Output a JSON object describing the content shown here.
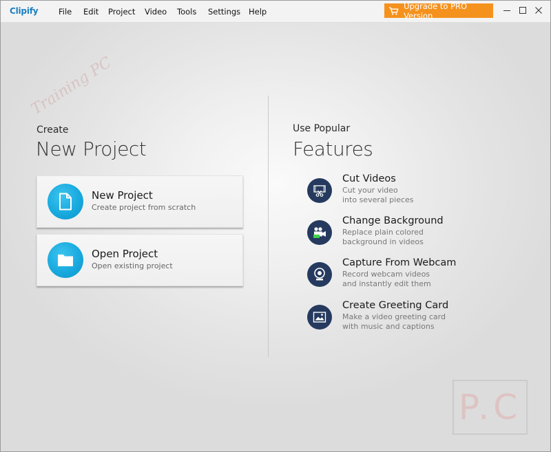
{
  "app": {
    "logo": "Clipify"
  },
  "menu": [
    "File",
    "Edit",
    "Project",
    "Video",
    "Tools",
    "Settings",
    "Help"
  ],
  "upgrade_label": "Upgrade to PRO Version",
  "colors": {
    "accent_orange": "#f5921e",
    "card_blue": "#16a7dd",
    "feature_navy": "#253a5e",
    "logo_blue": "#1a7fc1"
  },
  "create": {
    "kicker": "Create",
    "title": "New Project",
    "cards": [
      {
        "title": "New Project",
        "subtitle": "Create project from scratch",
        "icon": "file-icon"
      },
      {
        "title": "Open Project",
        "subtitle": "Open existing project",
        "icon": "folder-icon"
      }
    ]
  },
  "features": {
    "kicker": "Use Popular",
    "title": "Features",
    "items": [
      {
        "title": "Cut Videos",
        "line1": "Cut your video",
        "line2": "into several pieces",
        "icon": "cut-video-icon"
      },
      {
        "title": "Change Background",
        "line1": "Replace plain colored",
        "line2": "background in videos",
        "icon": "chroma-key-icon"
      },
      {
        "title": "Capture From Webcam",
        "line1": "Record webcam videos",
        "line2": "and instantly edit them",
        "icon": "webcam-icon"
      },
      {
        "title": "Create Greeting Card",
        "line1": "Make a video greeting card",
        "line2": "with music and captions",
        "icon": "greeting-card-icon"
      }
    ]
  },
  "watermark": {
    "script": "Training PC",
    "box": "P.C"
  }
}
